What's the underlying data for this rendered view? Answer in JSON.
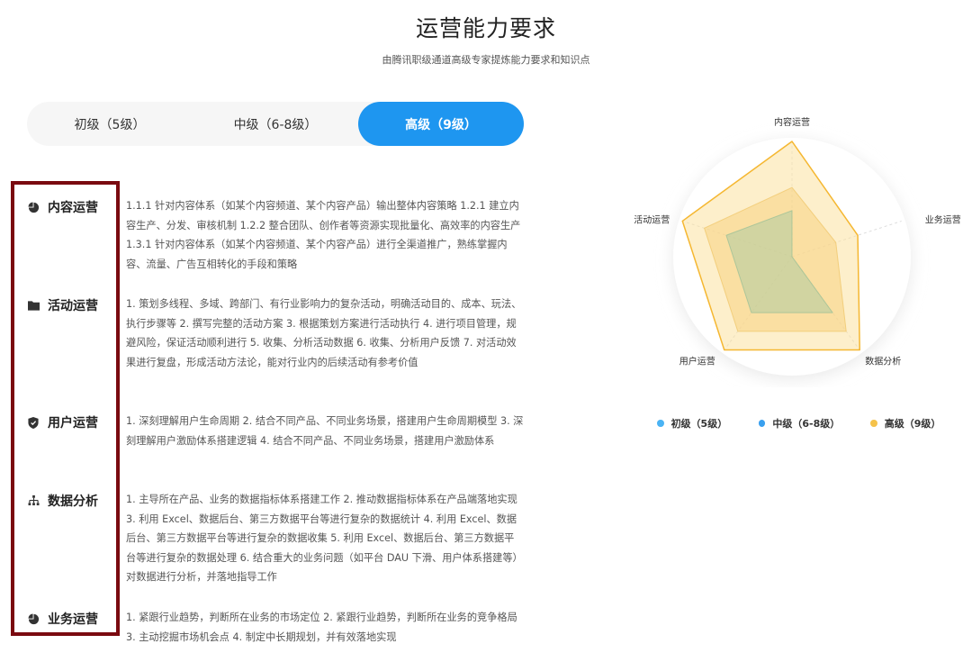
{
  "header": {
    "title": "运营能力要求",
    "subtitle": "由腾讯职级通道高级专家提炼能力要求和知识点"
  },
  "tabs": [
    {
      "label": "初级（5级）",
      "active": false
    },
    {
      "label": "中级（6-8级）",
      "active": false
    },
    {
      "label": "高级（9级）",
      "active": true
    }
  ],
  "sections": [
    {
      "label": "内容运营",
      "icon": "pie-chart-icon",
      "text": "1.1.1 针对内容体系（如某个内容频道、某个内容产品）输出整体内容策略 1.2.1 建立内容生产、分发、审核机制 1.2.2 整合团队、创作者等资源实现批量化、高效率的内容生产 1.3.1 针对内容体系（如某个内容频道、某个内容产品）进行全渠道推广，熟练掌握内容、流量、广告互相转化的手段和策略"
    },
    {
      "label": "活动运营",
      "icon": "folder-icon",
      "text": "1. 策划多线程、多域、跨部门、有行业影响力的复杂活动，明确活动目的、成本、玩法、执行步骤等 2. 撰写完整的活动方案 3. 根据策划方案进行活动执行 4. 进行项目管理，规避风险，保证活动顺利进行 5. 收集、分析活动数据 6. 收集、分析用户反馈 7. 对活动效果进行复盘，形成活动方法论，能对行业内的后续活动有参考价值"
    },
    {
      "label": "用户运营",
      "icon": "shield-icon",
      "text": "1. 深刻理解用户生命周期 2. 结合不同产品、不同业务场景，搭建用户生命周期模型 3. 深刻理解用户激励体系搭建逻辑 4. 结合不同产品、不同业务场景，搭建用户激励体系"
    },
    {
      "label": "数据分析",
      "icon": "hierarchy-icon",
      "text": "1. 主导所在产品、业务的数据指标体系搭建工作 2. 推动数据指标体系在产品端落地实现 3. 利用 Excel、数据后台、第三方数据平台等进行复杂的数据统计 4. 利用 Excel、数据后台、第三方数据平台等进行复杂的数据收集 5. 利用 Excel、数据后台、第三方数据平台等进行复杂的数据处理 6. 结合重大的业务问题（如平台 DAU 下滑、用户体系搭建等）对数据进行分析，并落地指导工作"
    },
    {
      "label": "业务运营",
      "icon": "pie-chart-icon",
      "text": "1. 紧跟行业趋势，判断所在业务的市场定位 2. 紧跟行业趋势，判断所在业务的竞争格局 3. 主动挖掘市场机会点 4. 制定中长期规划，并有效落地实现"
    }
  ],
  "chart_data": {
    "type": "radar",
    "axes": [
      "内容运营",
      "业务运营",
      "数据分析",
      "用户运营",
      "活动运营"
    ],
    "max": 100,
    "series": [
      {
        "name": "初级（5级）",
        "color": "#7fb9a0",
        "values": [
          40,
          0,
          60,
          60,
          60
        ]
      },
      {
        "name": "中级（6-8级）",
        "color": "#f5c86a",
        "values": [
          60,
          40,
          80,
          80,
          80
        ]
      },
      {
        "name": "高级（9级）",
        "color": "#f5b731",
        "values": [
          100,
          60,
          100,
          100,
          100
        ]
      }
    ],
    "legend": [
      {
        "label": "初级（5级）",
        "color": "#4ab3f4"
      },
      {
        "label": "中级（6-8级）",
        "color": "#3aa0ef"
      },
      {
        "label": "高级（9级）",
        "color": "#f5c24a"
      }
    ]
  }
}
